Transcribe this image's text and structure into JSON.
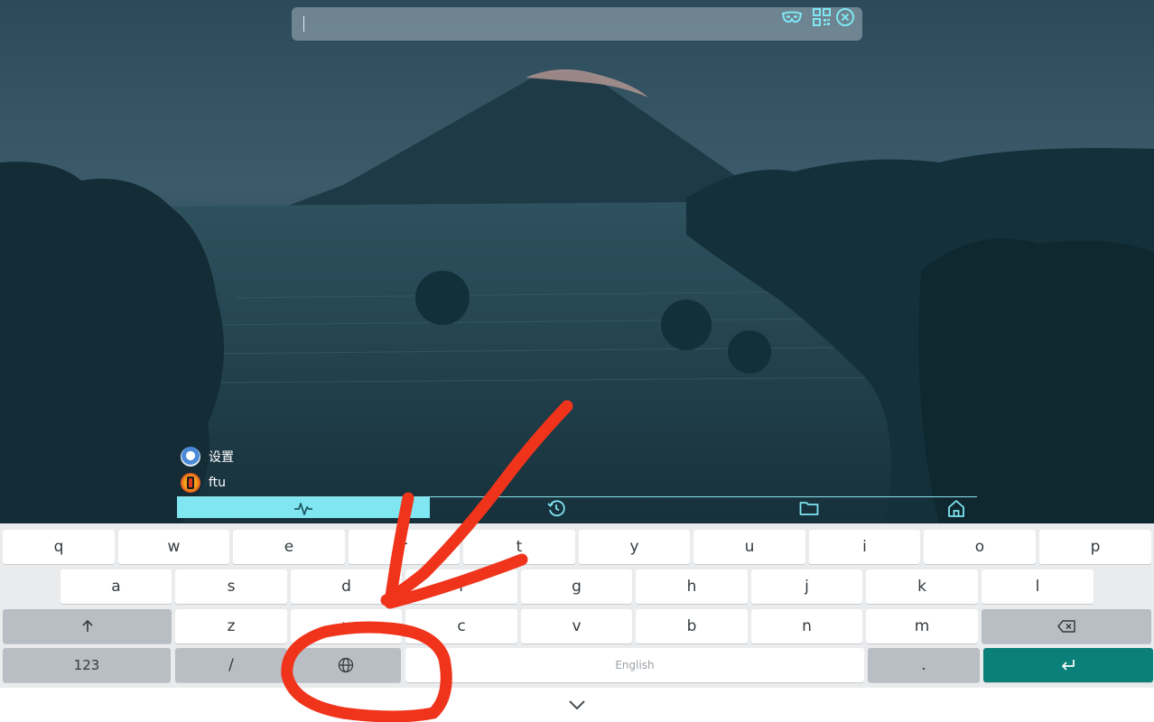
{
  "search": {
    "value": "",
    "placeholder": ""
  },
  "apps": [
    {
      "label": "设置",
      "icon": "settings-app-icon"
    },
    {
      "label": "ftu",
      "icon": "ftu-app-icon"
    }
  ],
  "tabs": [
    {
      "icon": "activity-icon",
      "active": true
    },
    {
      "icon": "history-icon",
      "active": false
    },
    {
      "icon": "folder-icon",
      "active": false
    },
    {
      "icon": "home-icon",
      "active": false
    }
  ],
  "keyboard": {
    "row1": [
      "q",
      "w",
      "e",
      "r",
      "t",
      "y",
      "u",
      "i",
      "o",
      "p"
    ],
    "row2": [
      "a",
      "s",
      "d",
      "f",
      "g",
      "h",
      "j",
      "k",
      "l"
    ],
    "row3": [
      "z",
      "x",
      "c",
      "v",
      "b",
      "n",
      "m"
    ],
    "numbers_label": "123",
    "slash_label": "/",
    "space_label": "English",
    "period_label": ".",
    "icons": [
      "shift-icon",
      "backspace-icon",
      "globe-icon",
      "enter-icon",
      "chevron-down-icon"
    ]
  },
  "colors": {
    "accent": "#7fe6f2",
    "enter_key": "#0b7f7a",
    "annotation": "#f0341c"
  }
}
